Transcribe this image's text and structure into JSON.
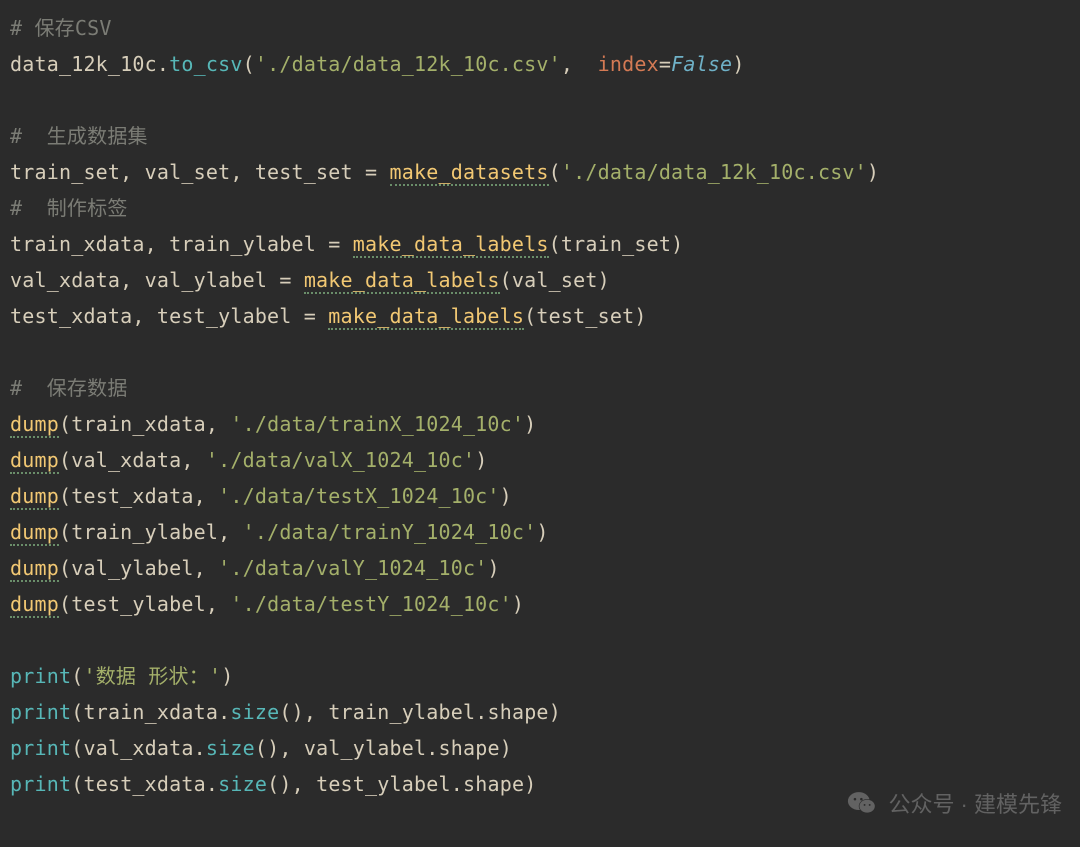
{
  "code": {
    "l1": {
      "comment": "# 保存CSV"
    },
    "l2": {
      "v": "data_12k_10c",
      "dot": ".",
      "m": "to_csv",
      "lp": "(",
      "s": "'./data/data_12k_10c.csv'",
      "comma": ",  ",
      "kw": "index",
      "eq": "=",
      "lit": "False",
      "rp": ")"
    },
    "l3": {
      "blank": ""
    },
    "l4": {
      "comment": "#  生成数据集"
    },
    "l5": {
      "lhs": "train_set, val_set, test_set ",
      "eq": "=",
      "sp": " ",
      "fn": "make_datasets",
      "lp": "(",
      "s": "'./data/data_12k_10c.csv'",
      "rp": ")"
    },
    "l6": {
      "comment": "#  制作标签"
    },
    "l7": {
      "a": "train_xdata, train_ylabel ",
      "eq": "=",
      "sp": " ",
      "fn": "make_data_labels",
      "lp": "(",
      "arg": "train_set",
      "rp": ")"
    },
    "l8": {
      "a": "val_xdata, val_ylabel ",
      "eq": "=",
      "sp": " ",
      "fn": "make_data_labels",
      "lp": "(",
      "arg": "val_set",
      "rp": ")"
    },
    "l9": {
      "a": "test_xdata, test_ylabel ",
      "eq": "=",
      "sp": " ",
      "fn": "make_data_labels",
      "lp": "(",
      "arg": "test_set",
      "rp": ")"
    },
    "l10": {
      "blank": ""
    },
    "l11": {
      "comment": "#  保存数据"
    },
    "l12": {
      "fn": "dump",
      "lp": "(",
      "arg": "train_xdata, ",
      "s": "'./data/trainX_1024_10c'",
      "rp": ")"
    },
    "l13": {
      "fn": "dump",
      "lp": "(",
      "arg": "val_xdata, ",
      "s": "'./data/valX_1024_10c'",
      "rp": ")"
    },
    "l14": {
      "fn": "dump",
      "lp": "(",
      "arg": "test_xdata, ",
      "s": "'./data/testX_1024_10c'",
      "rp": ")"
    },
    "l15": {
      "fn": "dump",
      "lp": "(",
      "arg": "train_ylabel, ",
      "s": "'./data/trainY_1024_10c'",
      "rp": ")"
    },
    "l16": {
      "fn": "dump",
      "lp": "(",
      "arg": "val_ylabel, ",
      "s": "'./data/valY_1024_10c'",
      "rp": ")"
    },
    "l17": {
      "fn": "dump",
      "lp": "(",
      "arg": "test_ylabel, ",
      "s": "'./data/testY_1024_10c'",
      "rp": ")"
    },
    "l18": {
      "blank": ""
    },
    "l19": {
      "fn": "print",
      "lp": "(",
      "s": "'数据 形状：'",
      "rp": ")"
    },
    "l20": {
      "fn": "print",
      "lp": "(",
      "v1": "train_xdata",
      "dot1": ".",
      "m1": "size",
      "p1": "(), ",
      "v2": "train_ylabel",
      "dot2": ".",
      "attr": "shape",
      "rp": ")"
    },
    "l21": {
      "fn": "print",
      "lp": "(",
      "v1": "val_xdata",
      "dot1": ".",
      "m1": "size",
      "p1": "(), ",
      "v2": "val_ylabel",
      "dot2": ".",
      "attr": "shape",
      "rp": ")"
    },
    "l22": {
      "fn": "print",
      "lp": "(",
      "v1": "test_xdata",
      "dot1": ".",
      "m1": "size",
      "p1": "(), ",
      "v2": "test_ylabel",
      "dot2": ".",
      "attr": "shape",
      "rp": ")"
    }
  },
  "watermark": {
    "label": "公众号 · 建模先锋"
  }
}
